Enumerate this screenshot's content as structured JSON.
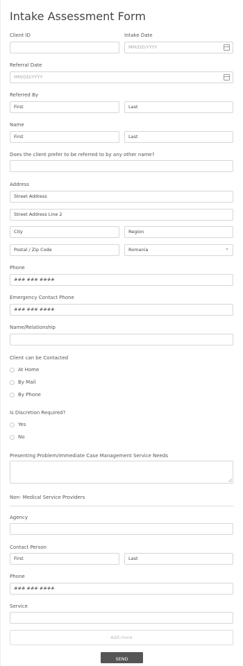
{
  "form": {
    "title": "Intake Assessment Form",
    "client_id_label": "Client ID",
    "intake_date_label": "Intake Date",
    "intake_date_placeholder": "MM/DD/YYYY",
    "referral_date_label": "Referral Date",
    "referral_date_placeholder": "MM/DD/YYYY",
    "referred_by_label": "Referred By",
    "referred_by_first": "First",
    "referred_by_last": "Last",
    "name_label": "Name",
    "name_first": "First",
    "name_last": "Last",
    "other_name_label": "Does the client prefer to be referred to by any other name?",
    "address_label": "Address",
    "street_address": "Street Address",
    "street_address_2": "Street Address Line 2",
    "city": "City",
    "region": "Region",
    "postal": "Postal / Zip Code",
    "country": "Romania",
    "phone_label": "Phone",
    "phone_placeholder": "### ### ####",
    "emergency_phone_label": "Emergency Contact Phone",
    "emergency_phone_placeholder": "### ### ####",
    "relationship_label": "Name/Relationship",
    "contact_label": "Client can be Contacted",
    "contact_options": [
      "At Home",
      "By Mail",
      "By Phone"
    ],
    "discretion_label": "Is Discretion Required?",
    "discretion_options": [
      "Yes",
      "No"
    ],
    "problem_label": "Presenting Problem/Immediate Case Management Service Needs",
    "section_heading": "Non- Medical Service Providers",
    "agency_label": "Agency",
    "contact_person_label": "Contact Person",
    "contact_person_first": "First",
    "contact_person_last": "Last",
    "provider_phone_label": "Phone",
    "provider_phone_placeholder": "### ### ####",
    "service_label": "Service",
    "add_more": "Add more",
    "send": "SEND"
  }
}
